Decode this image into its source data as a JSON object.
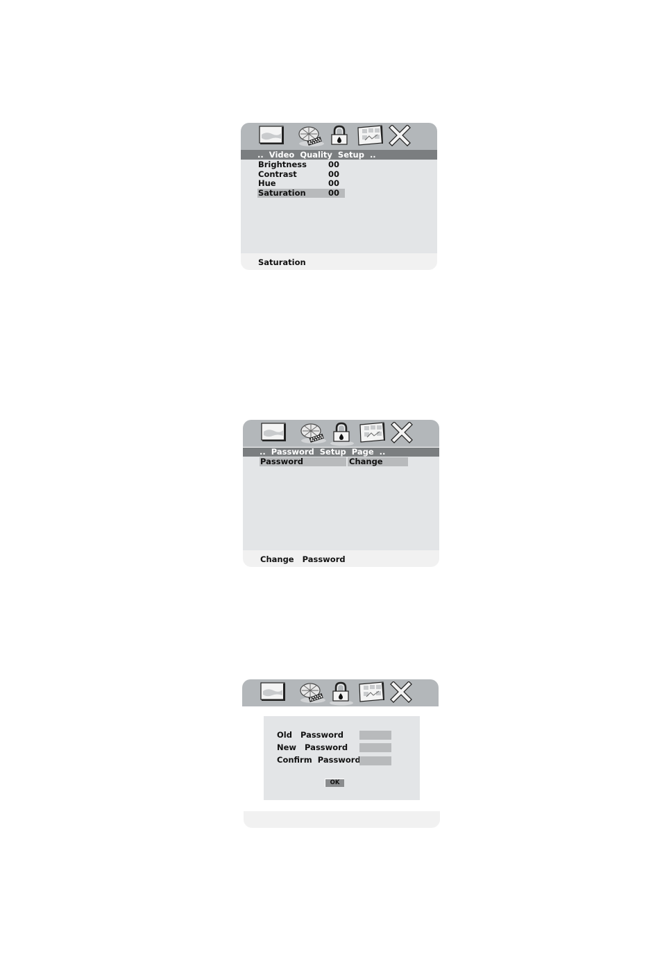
{
  "icons": [
    {
      "name": "tv-general-setup-icon"
    },
    {
      "name": "film-reel-video-icon"
    },
    {
      "name": "lock-password-icon"
    },
    {
      "name": "picture-preference-icon"
    },
    {
      "name": "close-exit-icon"
    }
  ],
  "panels": [
    {
      "selected_icon": "film-reel-video-icon",
      "title": "..  Video  Quality  Setup  ..",
      "rows": [
        {
          "label": "Brightness",
          "value": "00",
          "selected": false
        },
        {
          "label": "Contrast",
          "value": "00",
          "selected": false
        },
        {
          "label": "Hue",
          "value": "00",
          "selected": false
        },
        {
          "label": "Saturation",
          "value": "00",
          "selected": true
        }
      ],
      "footer": "Saturation"
    },
    {
      "selected_icon": "lock-password-icon",
      "title": "..  Password  Setup  Page  ..",
      "row": {
        "label": "Password",
        "value": "Change"
      },
      "footer": "Change   Password"
    },
    {
      "selected_icon": "lock-password-icon",
      "dialog": {
        "fields": [
          {
            "label": "Old   Password",
            "value": ""
          },
          {
            "label": "New   Password",
            "value": ""
          },
          {
            "label": "Confirm  Password",
            "value": ""
          }
        ],
        "ok_label": "OK"
      },
      "footer": ""
    }
  ],
  "colors": {
    "header": "#b3b7ba",
    "titlebar": "#7b7e80",
    "body": "#e3e5e7",
    "footer": "#f1f1f1",
    "selection": "#b8babc"
  }
}
